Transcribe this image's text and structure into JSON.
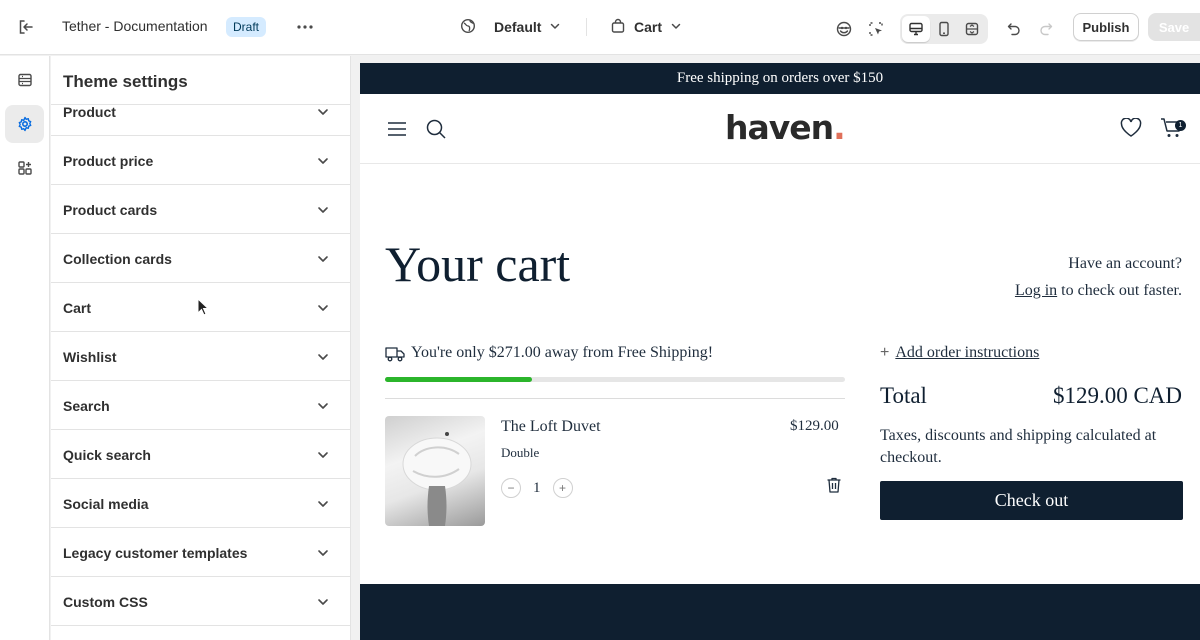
{
  "topbar": {
    "title": "Tether - Documentation",
    "badge": "Draft",
    "theme_selector": "Default",
    "page_selector": "Cart",
    "publish_label": "Publish",
    "save_label": "Save"
  },
  "rail": {
    "items": [
      {
        "icon": "sections-icon",
        "active": false
      },
      {
        "icon": "gear-icon",
        "active": true
      },
      {
        "icon": "apps-icon",
        "active": false
      }
    ]
  },
  "panel": {
    "title": "Theme settings",
    "items": [
      {
        "label": "Product"
      },
      {
        "label": "Product price"
      },
      {
        "label": "Product cards"
      },
      {
        "label": "Collection cards"
      },
      {
        "label": "Cart"
      },
      {
        "label": "Wishlist"
      },
      {
        "label": "Search"
      },
      {
        "label": "Quick search"
      },
      {
        "label": "Social media"
      },
      {
        "label": "Legacy customer templates"
      },
      {
        "label": "Custom CSS"
      }
    ]
  },
  "store": {
    "announcement": "Free shipping on orders over $150",
    "logo": "haven",
    "logo_dot": ".",
    "cart_count": "1",
    "cart_title": "Your cart",
    "have_account": "Have an account?",
    "login_link": "Log in",
    "login_suffix": " to check out faster.",
    "shipping_message": "You're only $271.00 away from Free Shipping!",
    "shipping_progress": 0.32,
    "item": {
      "name": "The Loft Duvet",
      "variant": "Double",
      "quantity": "1",
      "price": "$129.00"
    },
    "add_instructions": "Add order instructions",
    "total_label": "Total",
    "total_value": "$129.00 CAD",
    "tax_note": "Taxes, discounts and shipping calculated at checkout.",
    "checkout_label": "Check out"
  },
  "colors": {
    "navy": "#0f1f30",
    "progress": "#2bb52b",
    "accent_dot": "#e0705a",
    "badge_bg": "#d5ebff"
  }
}
